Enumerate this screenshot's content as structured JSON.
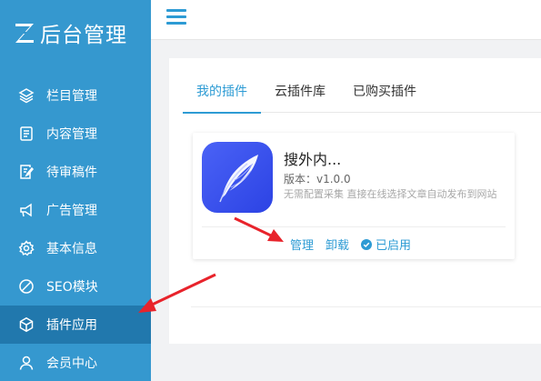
{
  "app": {
    "title": "后台管理"
  },
  "sidebar": {
    "items": [
      {
        "label": "栏目管理",
        "icon": "layers-icon"
      },
      {
        "label": "内容管理",
        "icon": "document-icon"
      },
      {
        "label": "待审稿件",
        "icon": "edit-document-icon"
      },
      {
        "label": "广告管理",
        "icon": "megaphone-icon"
      },
      {
        "label": "基本信息",
        "icon": "gear-icon"
      },
      {
        "label": "SEO模块",
        "icon": "seo-icon"
      },
      {
        "label": "插件应用",
        "icon": "cube-icon",
        "active": true
      },
      {
        "label": "会员中心",
        "icon": "user-icon"
      }
    ]
  },
  "tabs": [
    {
      "label": "我的插件",
      "active": true
    },
    {
      "label": "云插件库"
    },
    {
      "label": "已购买插件"
    }
  ],
  "plugin": {
    "name": "搜外内...",
    "version": "版本：v1.0.0",
    "description": "无需配置采集 直接在线选择文章自动发布到网站",
    "actions": {
      "manage": "管理",
      "uninstall": "卸载"
    },
    "status": "已启用"
  },
  "colors": {
    "sidebar": "#3598cf",
    "sidebar_active": "#2178ad",
    "accent": "#2d9bd4",
    "arrow": "#e8232b"
  }
}
